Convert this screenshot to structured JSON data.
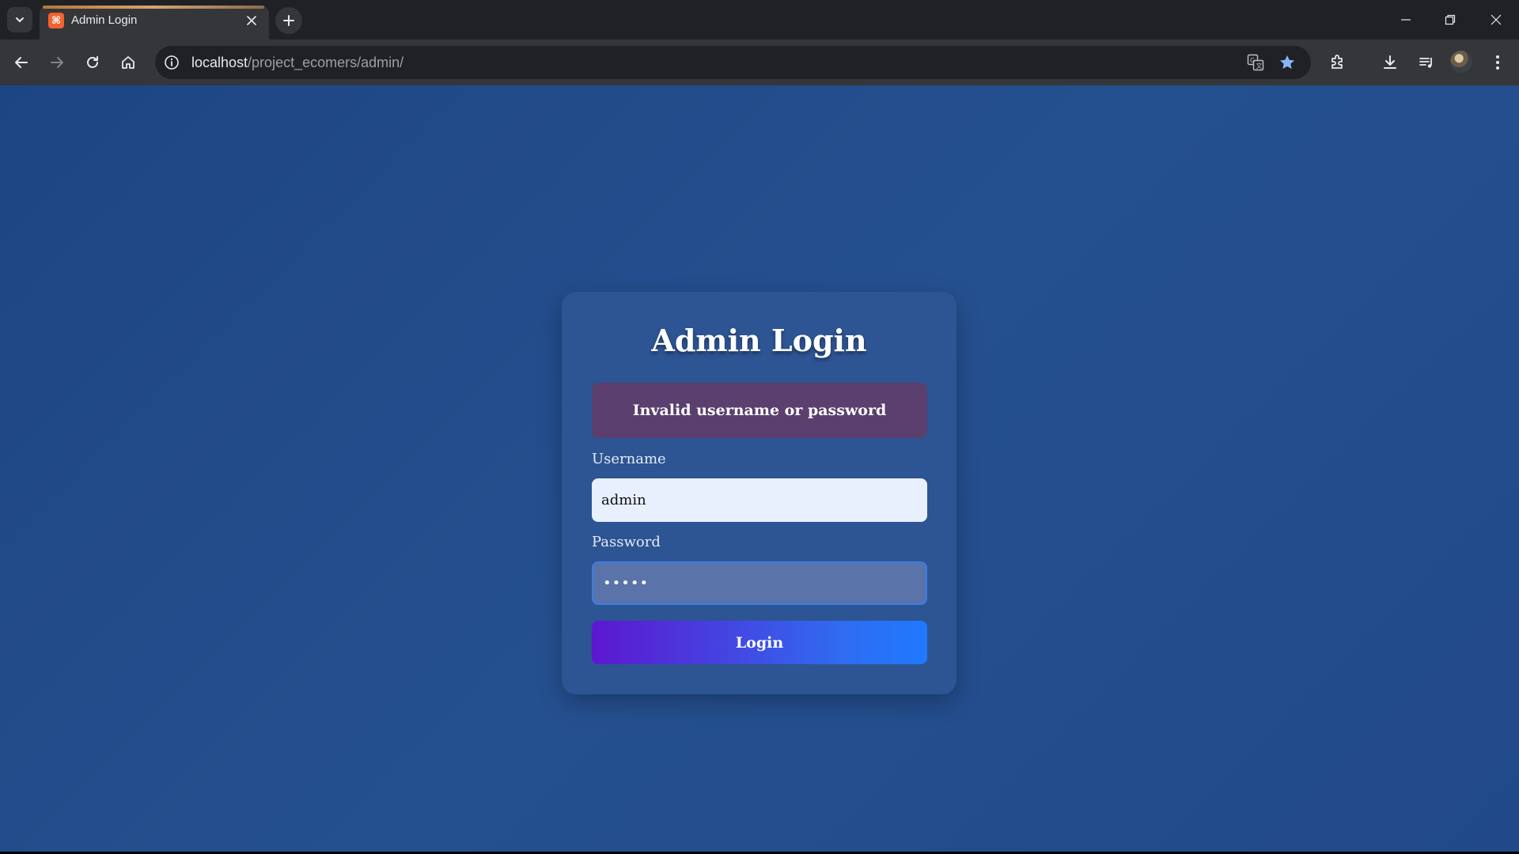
{
  "browser": {
    "tab_title": "Admin Login",
    "tab_favicon_glyph": "⌘",
    "url_host": "localhost",
    "url_path": "/project_ecomers/admin/",
    "accent_star": "#8ab4f8"
  },
  "login": {
    "title": "Admin Login",
    "error_message": "Invalid username or password",
    "username_label": "Username",
    "username_value": "admin",
    "password_label": "Password",
    "password_value": "•••••",
    "submit_label": "Login"
  },
  "colors": {
    "page_bg": "#234b8a",
    "card_bg": "#2d5493",
    "alert_bg": "#5a3f6f",
    "button_gradient_start": "#5d17d0",
    "button_gradient_end": "#1f79ff"
  }
}
